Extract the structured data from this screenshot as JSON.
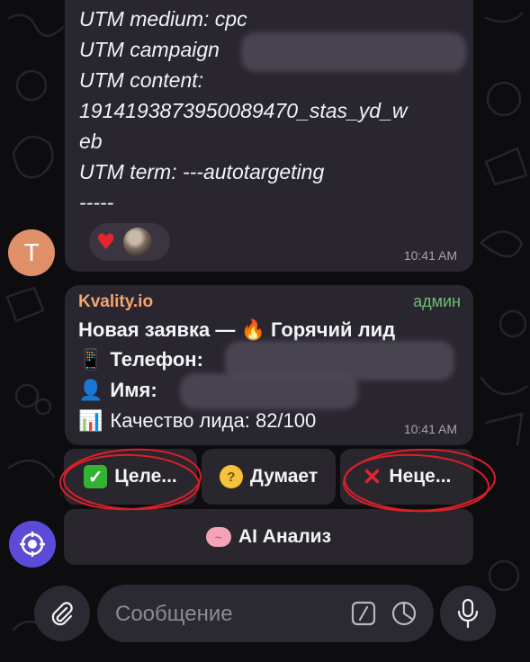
{
  "utm_message": {
    "lines": {
      "medium": "UTM medium: cpc",
      "campaign": "UTM campaign",
      "content_label": "UTM content:",
      "content_value_1": "1914193873950089470_stas_yd_w",
      "content_value_2": "eb",
      "term": "UTM term: ---autotargeting",
      "divider": "-----"
    },
    "reactions": [
      "heart",
      "user-avatar"
    ],
    "time": "10:41 AM",
    "sender_avatar_letter": "T"
  },
  "lead_message": {
    "sender": "Kvality.io",
    "badge": "админ",
    "title": "Новая заявка — 🔥 Горячий лид",
    "phone_label": "Телефон:",
    "name_label": "Имя:",
    "quality": "Качество лида: 82/100",
    "time": "10:41 AM"
  },
  "keyboard": {
    "target": "Целе...",
    "thinking": "Думает",
    "not_target": "Неце...",
    "ai_analysis": "AI Анализ"
  },
  "composer": {
    "placeholder": "Сообщение"
  },
  "colors": {
    "sender": "#f3a56c",
    "badge": "#6cbf73",
    "bubble": "#2a2630",
    "annotation": "#d8202a"
  }
}
